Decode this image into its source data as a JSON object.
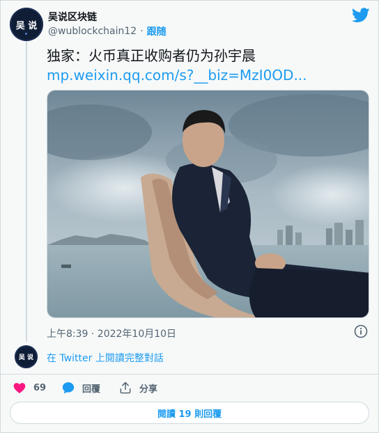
{
  "user": {
    "display_name": "吴说区块链",
    "handle": "@wublockchain12",
    "separator": "·",
    "follow_label": "跟随",
    "avatar_text": "吴 说"
  },
  "tweet": {
    "text": "独家：火币真正收购者仍为孙宇晨",
    "link": "mp.weixin.qq.com/s?__biz=MzI0OD...",
    "timestamp": "上午8:39 · 2022年10月10日"
  },
  "thread": {
    "avatar_text": "吴 说",
    "link_label": "在 Twitter 上閱讀完整對話"
  },
  "actions": {
    "like_count": "69",
    "reply_label": "回覆",
    "share_label": "分享"
  },
  "footer": {
    "read_replies_label": "閱讀 19 則回覆"
  },
  "icons": {
    "brand": "twitter-bird-icon",
    "info": "info-icon",
    "like": "heart-icon",
    "reply": "speech-bubble-icon",
    "share": "share-icon"
  },
  "colors": {
    "accent": "#1d9bf0",
    "like": "#f91880",
    "muted": "#536471",
    "text": "#0f1419"
  }
}
